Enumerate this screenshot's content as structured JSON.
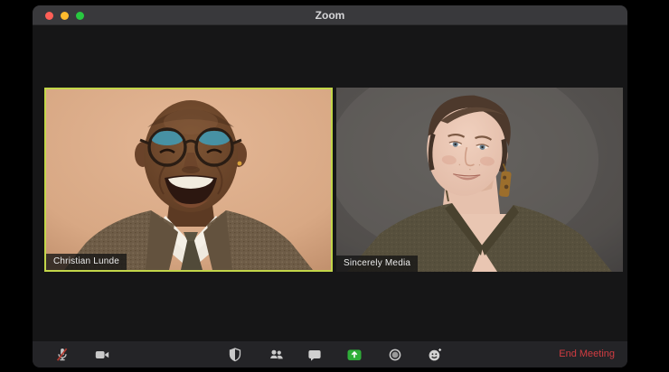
{
  "window": {
    "title": "Zoom",
    "controls": {
      "close": "close",
      "minimize": "minimize",
      "fullscreen": "fullscreen"
    }
  },
  "participants": [
    {
      "name": "Christian Lunde",
      "active_speaker": true,
      "video_on": true
    },
    {
      "name": "Sincerely Media",
      "active_speaker": false,
      "video_on": true
    }
  ],
  "toolbar": {
    "items": [
      {
        "id": "mute",
        "icon": "microphone-muted-icon",
        "state": "muted"
      },
      {
        "id": "video",
        "icon": "video-camera-icon"
      },
      {
        "id": "security",
        "icon": "shield-icon"
      },
      {
        "id": "participants",
        "icon": "participants-icon"
      },
      {
        "id": "chat",
        "icon": "chat-bubble-icon"
      },
      {
        "id": "share-screen",
        "icon": "share-screen-icon"
      },
      {
        "id": "record",
        "icon": "record-icon"
      },
      {
        "id": "reactions",
        "icon": "reactions-smiley-icon"
      }
    ],
    "end_meeting_label": "End Meeting"
  },
  "colors": {
    "active_speaker_border": "#c3d649",
    "share_screen_green": "#2fae39",
    "end_meeting_red": "#d13c41",
    "traffic_close": "#ff5f57",
    "traffic_minimize": "#febc2e",
    "traffic_zoom": "#28c840"
  }
}
